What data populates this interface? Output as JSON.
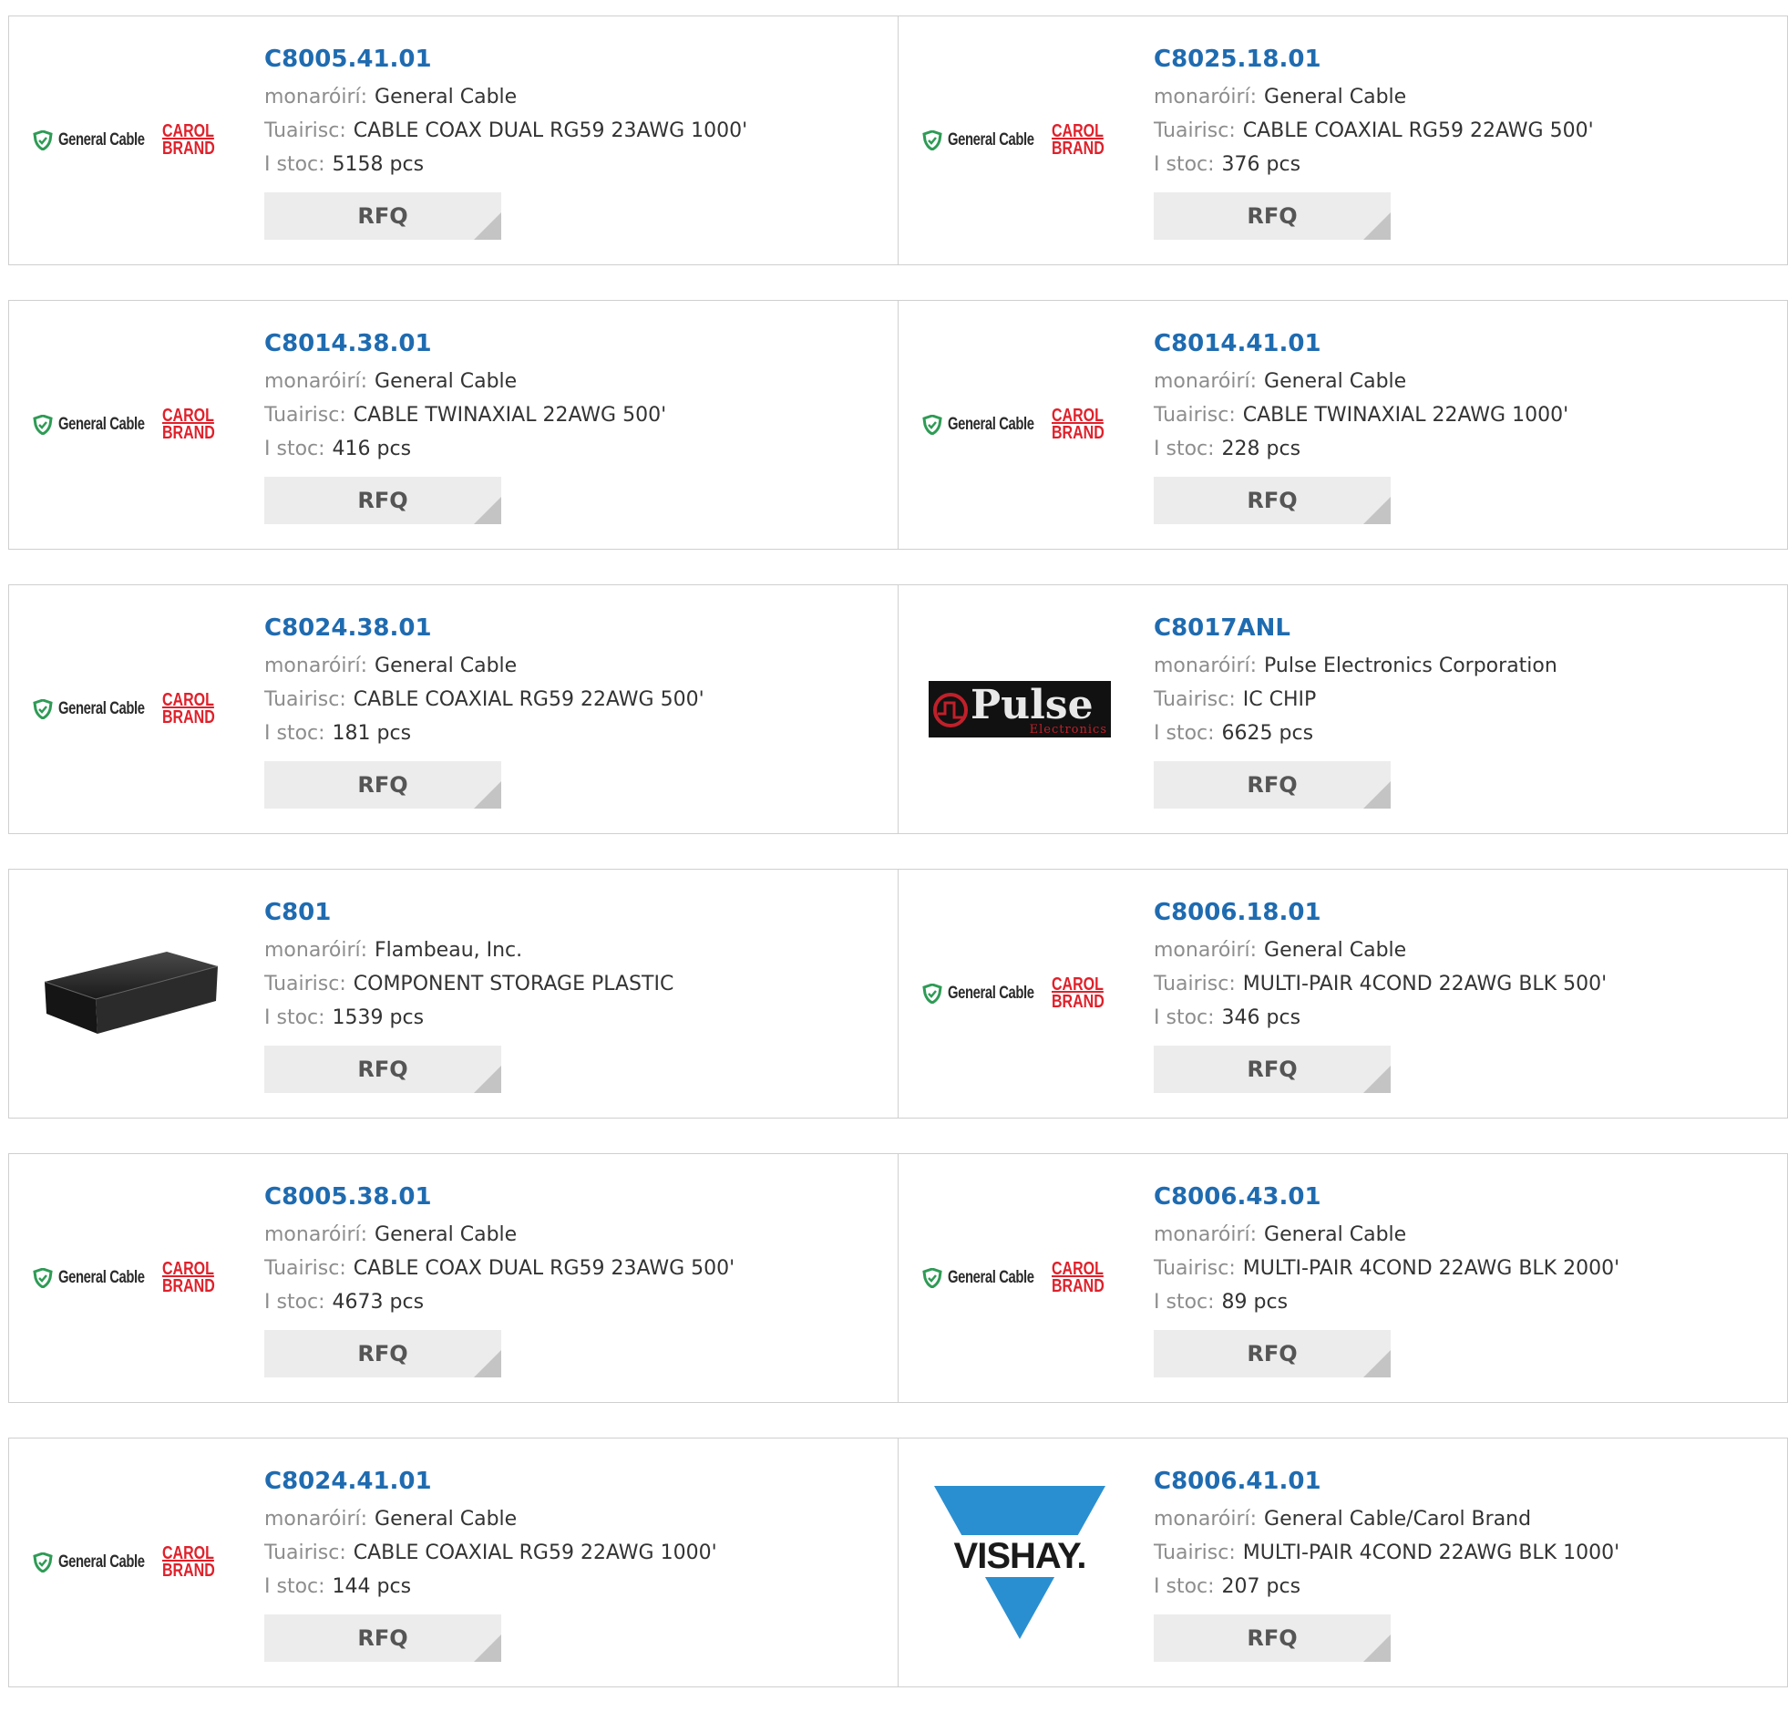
{
  "labels": {
    "manufacturer": "monaróirí:",
    "description": "Tuairisc:",
    "stock": "I stoc:",
    "rfq": "RFQ"
  },
  "colors": {
    "part_link": "#1f6bb0",
    "carol_red": "#e0202a",
    "gc_green": "#2e9b55",
    "vishay_blue": "#2a8fd0"
  },
  "logos": {
    "general_cable": {
      "brand": "General Cable",
      "carol_line1": "CAROL",
      "carol_line2": "BRAND",
      "icon": "shield-check-icon"
    },
    "pulse": {
      "word": "Pulse",
      "sub": "Electronics"
    },
    "vishay": {
      "word": "VISHAY."
    }
  },
  "products": [
    {
      "part": "C8005.41.01",
      "manufacturer": "General Cable",
      "description": "CABLE COAX DUAL RG59 23AWG 1000'",
      "stock": "5158 pcs",
      "logo": "general_cable"
    },
    {
      "part": "C8025.18.01",
      "manufacturer": "General Cable",
      "description": "CABLE COAXIAL RG59 22AWG 500'",
      "stock": "376 pcs",
      "logo": "general_cable"
    },
    {
      "part": "C8014.38.01",
      "manufacturer": "General Cable",
      "description": "CABLE TWINAXIAL 22AWG 500'",
      "stock": "416 pcs",
      "logo": "general_cable"
    },
    {
      "part": "C8014.41.01",
      "manufacturer": "General Cable",
      "description": "CABLE TWINAXIAL 22AWG 1000'",
      "stock": "228 pcs",
      "logo": "general_cable"
    },
    {
      "part": "C8024.38.01",
      "manufacturer": "General Cable",
      "description": "CABLE COAXIAL RG59 22AWG 500'",
      "stock": "181 pcs",
      "logo": "general_cable"
    },
    {
      "part": "C8017ANL",
      "manufacturer": "Pulse Electronics Corporation",
      "description": "IC CHIP",
      "stock": "6625 pcs",
      "logo": "pulse"
    },
    {
      "part": "C801",
      "manufacturer": "Flambeau, Inc.",
      "description": "COMPONENT STORAGE PLASTIC",
      "stock": "1539 pcs",
      "logo": "storage_box"
    },
    {
      "part": "C8006.18.01",
      "manufacturer": "General Cable",
      "description": "MULTI-PAIR 4COND 22AWG BLK 500'",
      "stock": "346 pcs",
      "logo": "general_cable"
    },
    {
      "part": "C8005.38.01",
      "manufacturer": "General Cable",
      "description": "CABLE COAX DUAL RG59 23AWG 500'",
      "stock": "4673 pcs",
      "logo": "general_cable"
    },
    {
      "part": "C8006.43.01",
      "manufacturer": "General Cable",
      "description": "MULTI-PAIR 4COND 22AWG BLK 2000'",
      "stock": "89 pcs",
      "logo": "general_cable"
    },
    {
      "part": "C8024.41.01",
      "manufacturer": "General Cable",
      "description": "CABLE COAXIAL RG59 22AWG 1000'",
      "stock": "144 pcs",
      "logo": "general_cable"
    },
    {
      "part": "C8006.41.01",
      "manufacturer": "General Cable/Carol Brand",
      "description": "MULTI-PAIR 4COND 22AWG BLK 1000'",
      "stock": "207 pcs",
      "logo": "vishay"
    }
  ]
}
